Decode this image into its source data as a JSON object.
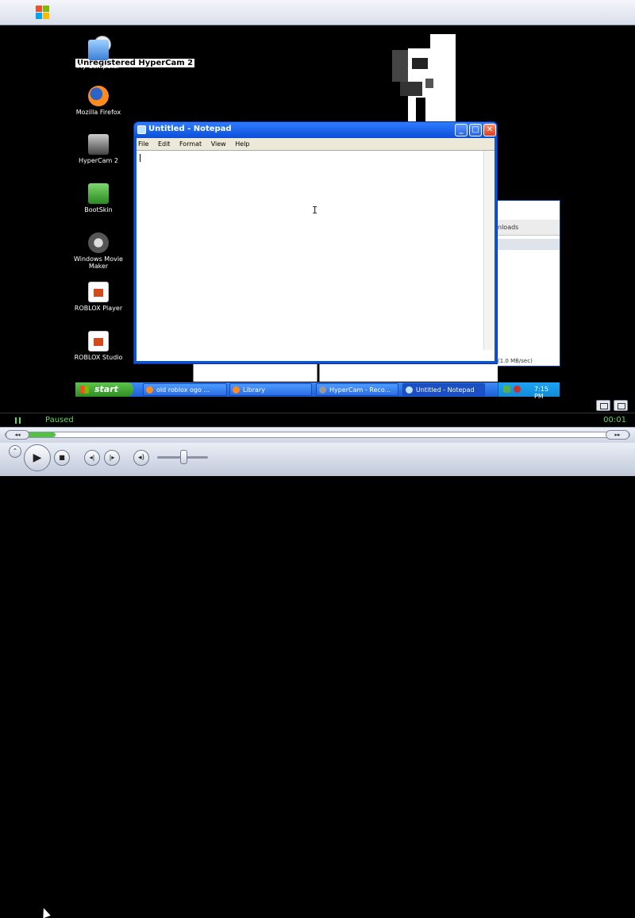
{
  "overlay": {
    "watermark": "Unregistered HyperCam 2"
  },
  "desktop": {
    "icons": [
      {
        "label": "My Computer"
      },
      {
        "label": "Mozilla Firefox"
      },
      {
        "label": "HyperCam 2"
      },
      {
        "label": "BootSkin"
      },
      {
        "label": "Windows Movie Maker"
      },
      {
        "label": "ROBLOX Player"
      },
      {
        "label": "ROBLOX Studio"
      }
    ]
  },
  "notepad": {
    "title": "Untitled - Notepad",
    "menu": [
      "File",
      "Edit",
      "Format",
      "View",
      "Help"
    ],
    "content": ""
  },
  "background_window": {
    "field": "nloads",
    "rate": "(1.0 MB/sec)"
  },
  "taskbar": {
    "start_label": "start",
    "buttons": [
      {
        "label": "old roblox ogo ..."
      },
      {
        "label": "Library"
      },
      {
        "label": "HyperCam - Reco..."
      },
      {
        "label": "Untitled - Notepad"
      }
    ],
    "clock": "7:15 PM"
  },
  "player": {
    "status": "Paused",
    "elapsed": "00:01",
    "seek_progress_percent": 8,
    "volume_percent": 50
  }
}
